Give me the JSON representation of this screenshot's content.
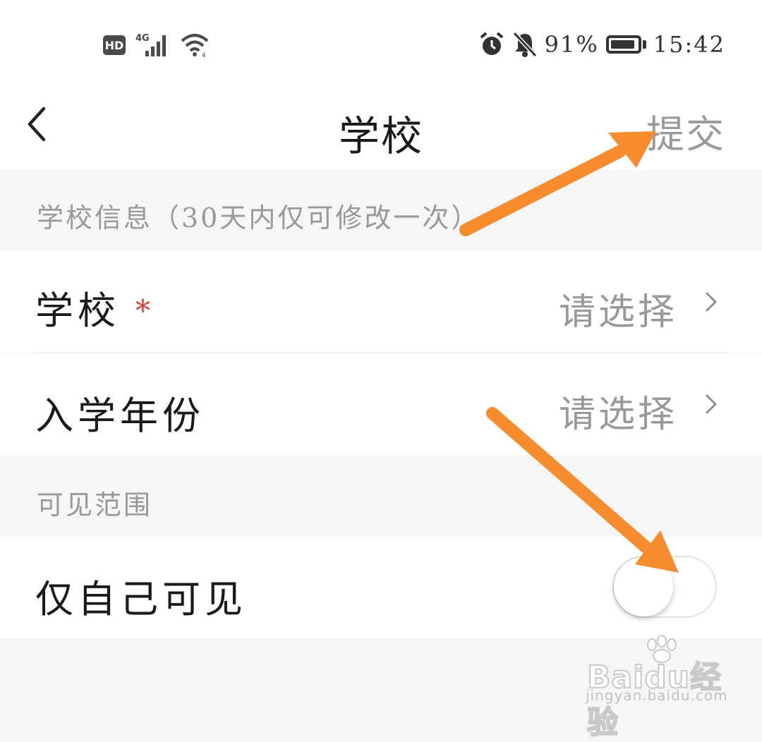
{
  "status_bar": {
    "hd": "HD",
    "network": "4G",
    "battery_percent": "91%",
    "battery_level": 0.91,
    "time": "15:42",
    "icons": [
      "hd-icon",
      "signal-icon",
      "wifi-icon",
      "alarm-icon",
      "bell-muted-icon",
      "battery-icon"
    ]
  },
  "navbar": {
    "back_icon": "chevron-left-icon",
    "title": "学校",
    "submit_label": "提交"
  },
  "sections": {
    "school_info": "学校信息（30天内仅可修改一次）",
    "visibility": "可见范围"
  },
  "rows": {
    "school": {
      "label": "学校",
      "required_mark": "*",
      "value": "请选择"
    },
    "enroll_year": {
      "label": "入学年份",
      "value": "请选择"
    },
    "only_me": {
      "label": "仅自己可见",
      "toggle_on": false
    }
  },
  "colors": {
    "accent_arrow": "#f78c2f",
    "required": "#d8423c",
    "muted_text": "#999999",
    "background": "#f6f6f6"
  },
  "watermark": {
    "logo": "Baidu经验",
    "url": "jingyan.baidu.com"
  }
}
